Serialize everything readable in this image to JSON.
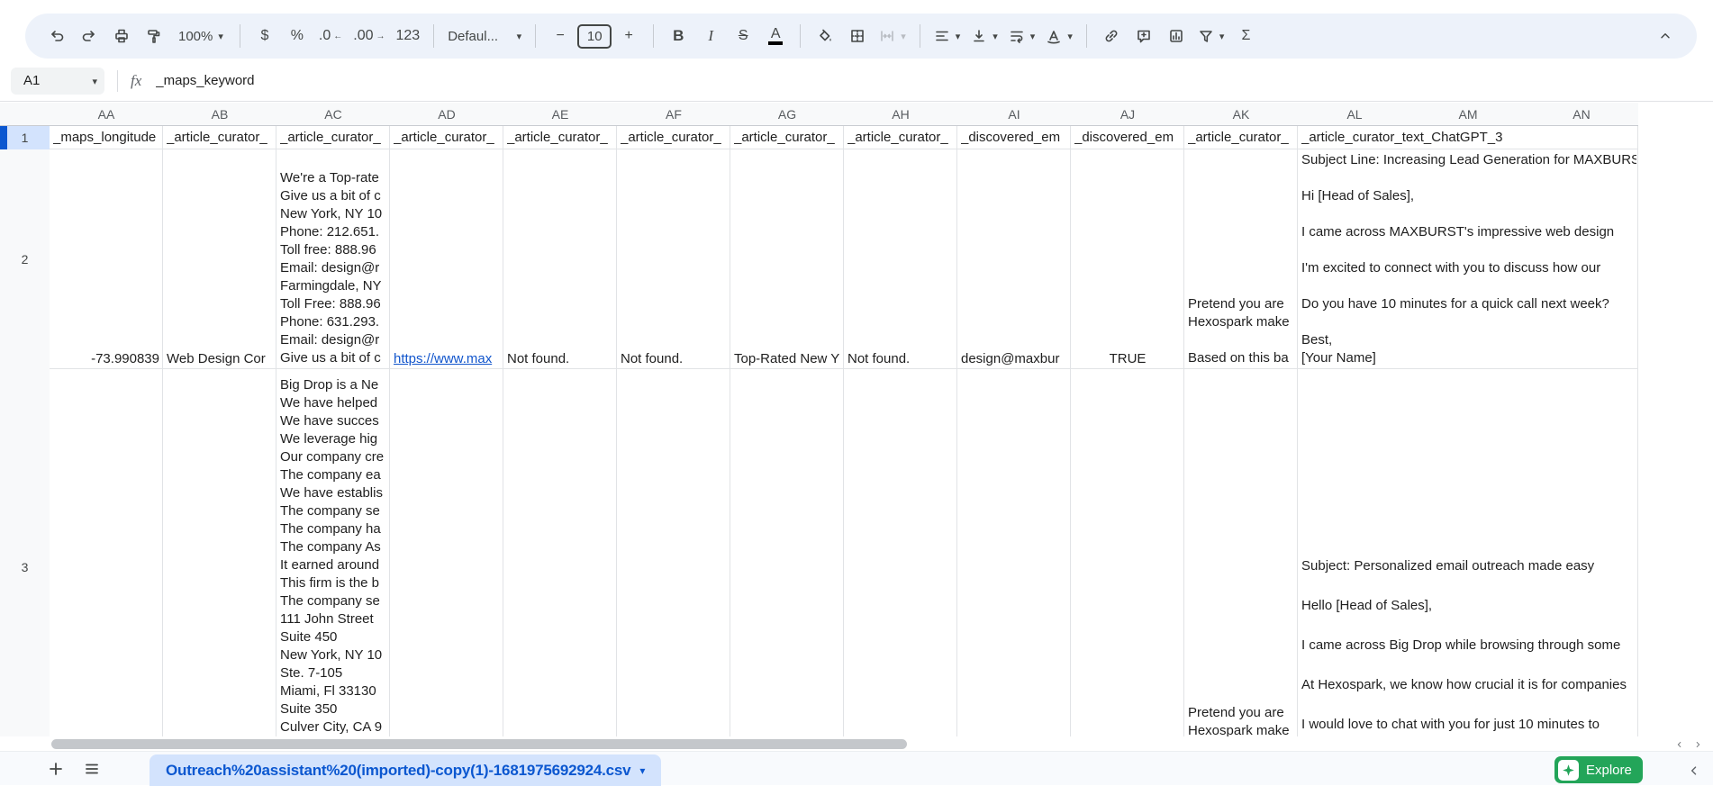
{
  "toolbar": {
    "zoom": "100%",
    "font": "Defaul...",
    "font_size": "10",
    "currency": "$",
    "percent": "%",
    "decrease_decimals": ".0",
    "increase_decimals": ".00",
    "more_formats": "123",
    "bold": "B",
    "italic": "I",
    "strikethrough": "S",
    "text_color": "A",
    "minus": "−",
    "plus": "+",
    "functions": "Σ"
  },
  "formula_bar": {
    "cell_ref": "A1",
    "formula": "_maps_keyword"
  },
  "grid": {
    "columns": [
      "AA",
      "AB",
      "AC",
      "AD",
      "AE",
      "AF",
      "AG",
      "AH",
      "AI",
      "AJ",
      "AK",
      "AL",
      "AM",
      "AN"
    ],
    "row_numbers": [
      "1",
      "2",
      "3"
    ],
    "header_row": [
      "_maps_longitude",
      "_article_curator_",
      "_article_curator_",
      "_article_curator_",
      "_article_curator_",
      "_article_curator_",
      "_article_curator_",
      "_article_curator_",
      "_discovered_em",
      "_discovered_em",
      "_article_curator_",
      "_article_curator_text_ChatGPT_3"
    ],
    "row2": {
      "aa": "-73.990839",
      "ab": "Web Design Cor",
      "ac": [
        "We're a Top-rate",
        "Give us a bit of c",
        "New York, NY 10",
        "Phone: 212.651.",
        "Toll free: 888.96",
        "Email: design@r",
        "Farmingdale, NY",
        "Toll Free: 888.96",
        "Phone: 631.293.",
        "Email: design@r",
        "Give us a bit of c"
      ],
      "ad_link": "https://www.max",
      "ae": "Not found.",
      "af": "Not found.",
      "ag": "Top-Rated New Y",
      "ah": "Not found.",
      "ai": "design@maxbur",
      "aj": "TRUE",
      "ak": [
        "Pretend you are",
        "Hexospark make",
        "",
        "Based on this ba"
      ],
      "al": [
        "Subject Line: Increasing Lead Generation for MAXBURST",
        "",
        "Hi [Head of Sales],",
        "",
        "I came across MAXBURST's impressive web design",
        "",
        "I'm excited to connect with you to discuss how our",
        "",
        "Do you have 10 minutes for a quick call next week?",
        "",
        "Best,",
        "[Your Name]"
      ]
    },
    "row3": {
      "ac": [
        "Big Drop is a Ne",
        "We have helped",
        "We have succes",
        "We leverage hig",
        "Our company cre",
        "The company ea",
        "We have establis",
        "The company se",
        "The company ha",
        "The company As",
        "It earned around",
        "This firm is the b",
        "The company se",
        "111 John Street",
        "Suite 450",
        "New York, NY 10",
        "Ste. 7-105",
        "Miami, Fl 33130",
        "Suite 350",
        "Culver City, CA 9"
      ],
      "ak": [
        "Pretend you are",
        "Hexospark make"
      ],
      "al": [
        "Subject: Personalized email outreach made easy",
        "",
        "Hello [Head of Sales],",
        "",
        "I came across Big Drop while browsing through some",
        "",
        "At Hexospark, we know how crucial it is for companies",
        "",
        "I would love to chat with you for just 10 minutes to"
      ]
    }
  },
  "sheet_bar": {
    "tab_name": "Outreach%20assistant%20(imported)-copy(1)-1681975692924.csv",
    "explore_label": "Explore"
  }
}
